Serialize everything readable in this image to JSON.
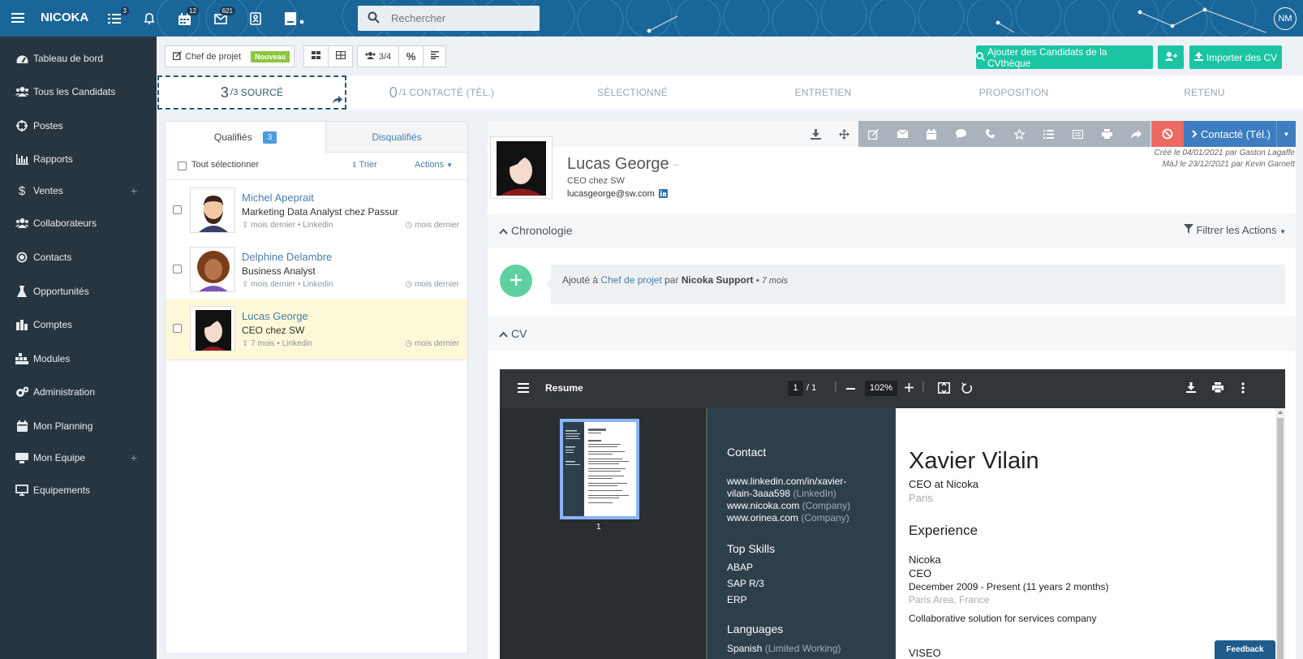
{
  "app": {
    "brand": "NICOKA",
    "user_initials": "NM",
    "search_placeholder": "Rechercher"
  },
  "topbar": {
    "badges": {
      "tasks": "3",
      "calendar": "12",
      "messages": "621"
    }
  },
  "sidebar": {
    "items": [
      {
        "label": "Tableau de bord",
        "icon": "dashboard-icon"
      },
      {
        "label": "Tous les Candidats",
        "icon": "users-icon"
      },
      {
        "label": "Postes",
        "icon": "crosshair-icon"
      },
      {
        "label": "Rapports",
        "icon": "bar-chart-icon"
      },
      {
        "label": "Ventes",
        "icon": "dollar-icon",
        "expandable": true
      },
      {
        "label": "Collaborateurs",
        "icon": "users-icon"
      },
      {
        "label": "Contacts",
        "icon": "target-icon"
      },
      {
        "label": "Opportunités",
        "icon": "flask-icon"
      },
      {
        "label": "Comptes",
        "icon": "building-icon"
      },
      {
        "label": "Modules",
        "icon": "modules-icon"
      },
      {
        "label": "Administration",
        "icon": "cogs-icon"
      },
      {
        "label": "Mon Planning",
        "icon": "calendar-icon"
      },
      {
        "label": "Mon Equipe",
        "icon": "team-icon",
        "expandable": true
      },
      {
        "label": "Equipements",
        "icon": "monitor-icon"
      }
    ],
    "plus": "+"
  },
  "toolbar": {
    "job_title": "Chef de projet",
    "job_badge": "Nouveau",
    "count_label": "3/4",
    "percent": "%",
    "add_from_cvtheque": "Ajouter des Candidats de la CVthèque",
    "import_cv": "Importer des CV"
  },
  "pipeline": {
    "stages": [
      {
        "count": "3",
        "total": "/3",
        "label": "SOURCÉ"
      },
      {
        "count": "0",
        "total": "/1",
        "label": "CONTACTÉ (TÉL.)"
      },
      {
        "label": "SÉLECTIONNÉ"
      },
      {
        "label": "ENTRETIEN"
      },
      {
        "label": "PROPOSITION"
      },
      {
        "label": "RETENU"
      }
    ]
  },
  "candidates_panel": {
    "tabs": {
      "qualified": "Qualifiés",
      "qualified_count": "3",
      "disqualified": "Disqualifiés"
    },
    "select_all": "Tout sélectionner",
    "sort": "Trier",
    "actions": "Actions",
    "list": [
      {
        "name": "Michel Apeprait",
        "job": "Marketing Data Analyst chez Passur",
        "meta": "mois dernier • Linkedin",
        "right": "mois dernier"
      },
      {
        "name": "Delphine Delambre",
        "job": "Business Analyst",
        "meta": "mois dernier • Linkedin",
        "right": "mois dernier"
      },
      {
        "name": "Lucas George",
        "job": "CEO chez SW",
        "meta": "7 mois • Linkedin",
        "right": "mois dernier",
        "selected": true
      }
    ]
  },
  "detail": {
    "status_button": "Contacté (Tél.)",
    "name": "Lucas George",
    "title": "CEO chez SW",
    "email": "lucasgeorge@sw.com",
    "created": "Créé le 04/01/2021 par Gaston Lagaffe",
    "updated": "MàJ le 23/12/2021 par Kevin Garnett",
    "chronology": "Chronologie",
    "filter_actions": "Filtrer les Actions",
    "event": {
      "prefix": "Ajouté à",
      "job": "Chef de projet",
      "by": "par",
      "author": "Nicoka Support",
      "when": "• 7 mois"
    },
    "cv": "CV"
  },
  "pdf": {
    "title": "Resume",
    "page": "1",
    "pages": "/ 1",
    "zoom": "102%",
    "thumb_label": "1",
    "left": {
      "contact_h": "Contact",
      "links": [
        {
          "text": "www.linkedin.com/in/xavier-",
          "note": ""
        },
        {
          "text": "vilain-3aaa598",
          "note": " (LinkedIn)"
        },
        {
          "text": "www.nicoka.com",
          "note": " (Company)"
        },
        {
          "text": "www.orinea.com",
          "note": " (Company)"
        }
      ],
      "skills_h": "Top Skills",
      "skills": [
        "ABAP",
        "SAP R/3",
        "ERP"
      ],
      "lang_h": "Languages",
      "lang": "Spanish",
      "lang_note": " (Limited Working)"
    },
    "right": {
      "name": "Xavier Vilain",
      "role": "CEO at Nicoka",
      "city": "Paris",
      "exp_h": "Experience",
      "company": "Nicoka",
      "position": "CEO",
      "dates": "December 2009 - Present (11 years 2 months)",
      "area": "Paris Area, France",
      "desc": "Collaborative solution for services company",
      "next": "VISEO"
    }
  },
  "feedback": "Feedback",
  "colors": {
    "topbar": "#1b6699",
    "sidebar": "#273541",
    "accent_green": "#1bc5a3",
    "status_blue": "#3d7dc0",
    "danger": "#ed6a62",
    "link": "#4a7dab"
  }
}
